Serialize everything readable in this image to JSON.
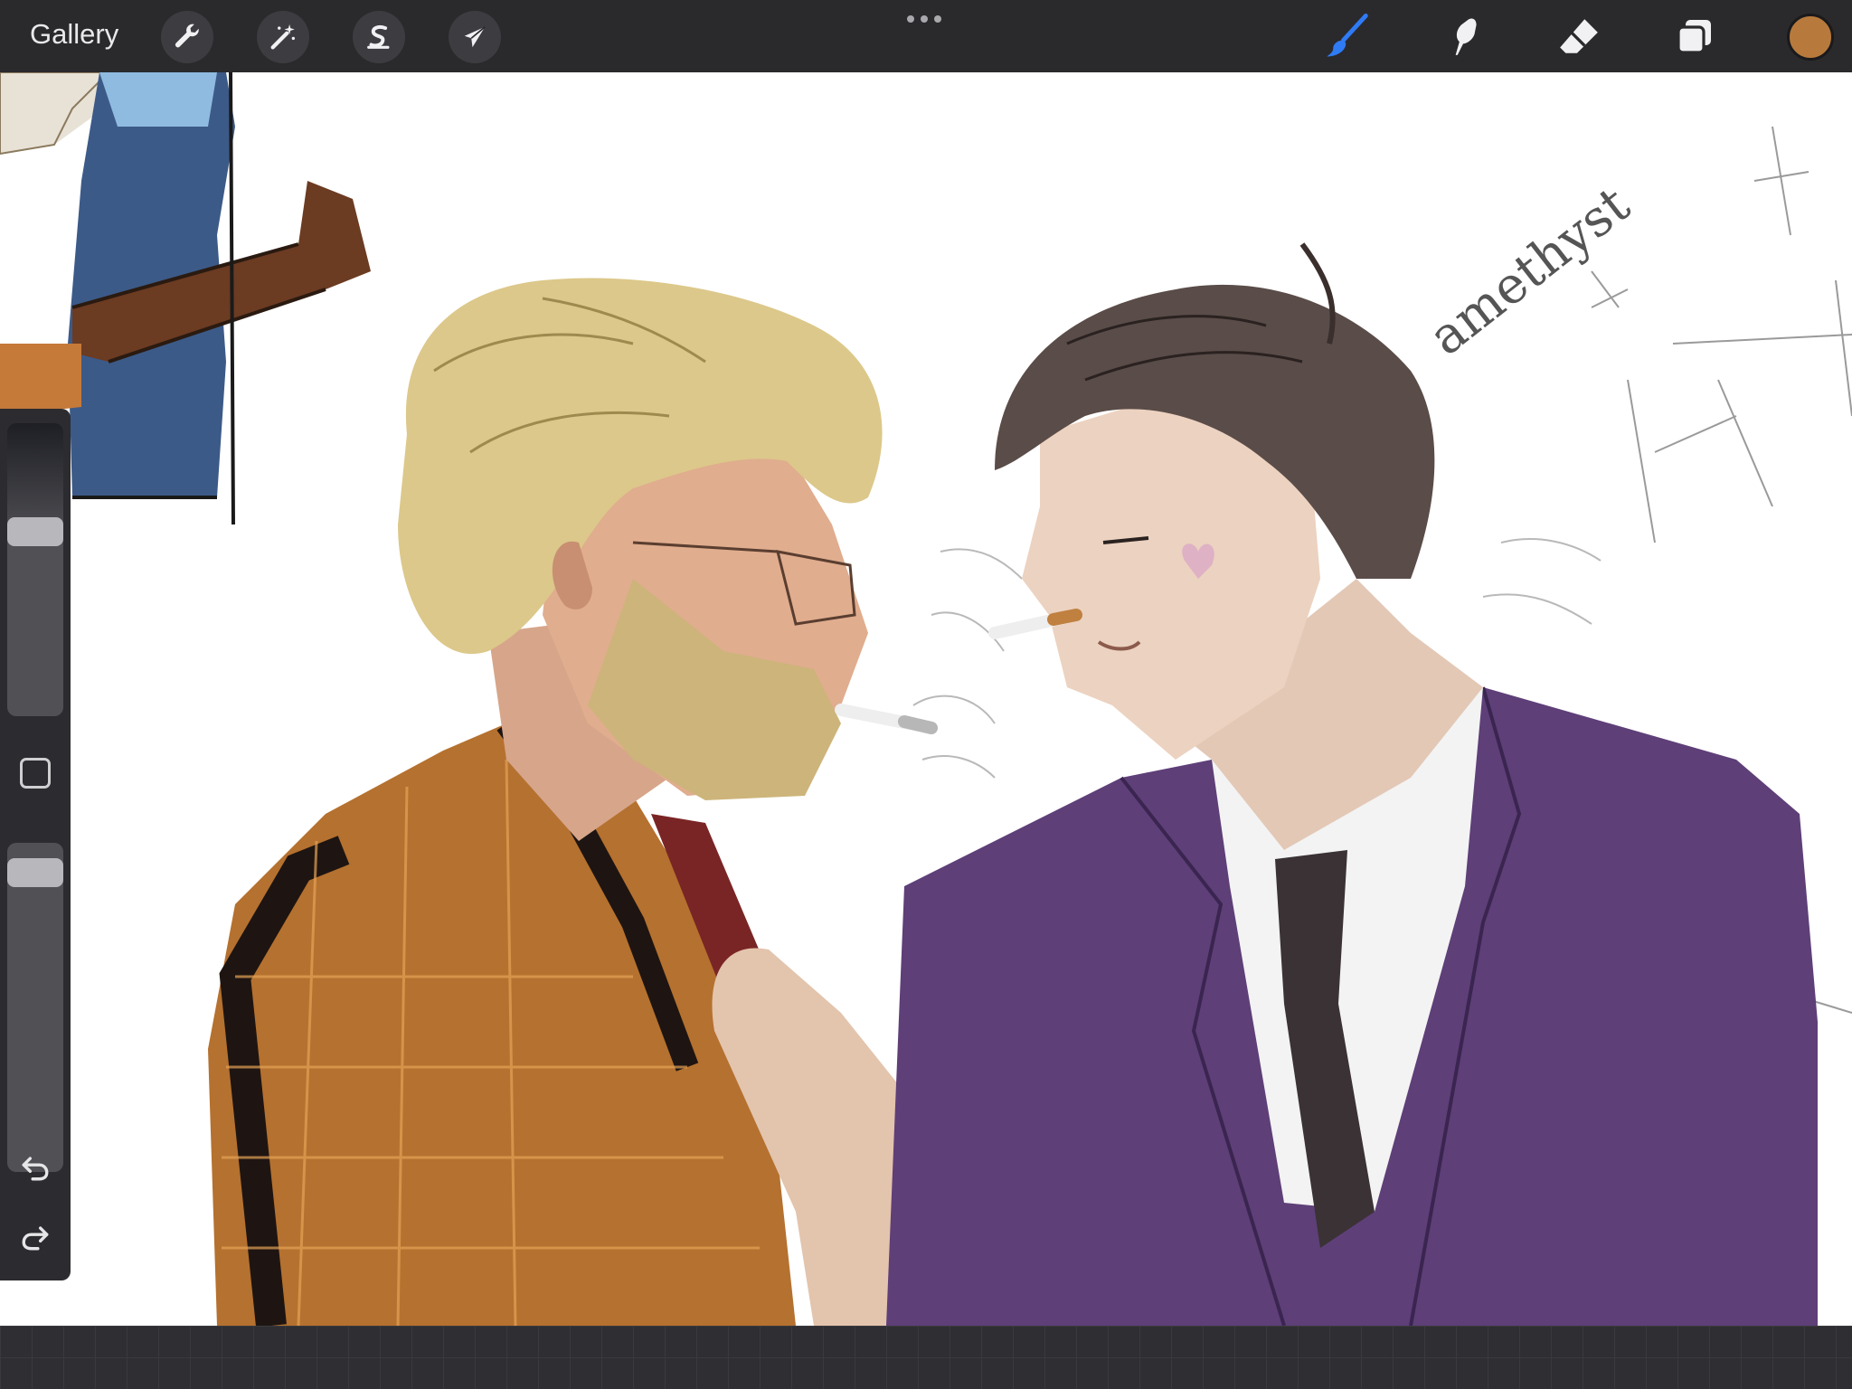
{
  "app": {
    "gallery_label": "Gallery"
  },
  "toolbar_left": [
    {
      "name": "actions",
      "icon": "wrench-icon"
    },
    {
      "name": "adjustments",
      "icon": "magic-wand-icon"
    },
    {
      "name": "selection",
      "icon": "selection-s-icon"
    },
    {
      "name": "transform",
      "icon": "arrow-cursor-icon"
    }
  ],
  "toolbar_right": [
    {
      "name": "brush",
      "icon": "brush-icon",
      "active": true
    },
    {
      "name": "smudge",
      "icon": "smudge-finger-icon"
    },
    {
      "name": "eraser",
      "icon": "eraser-icon"
    },
    {
      "name": "layers",
      "icon": "layers-icon"
    }
  ],
  "colors": {
    "current_color": "#b87a3c",
    "brush_active": "#2f7bf5",
    "jacket_purple": "#5e3f78",
    "shirt_orange": "#b5712f"
  },
  "sidebar": {
    "brush_size_level": 0.3,
    "opacity_level": 0.05,
    "undo_icon": "undo-icon",
    "redo_icon": "redo-icon",
    "modify_icon": "square-icon"
  },
  "canvas": {
    "handwritten_note": "amethyst"
  }
}
